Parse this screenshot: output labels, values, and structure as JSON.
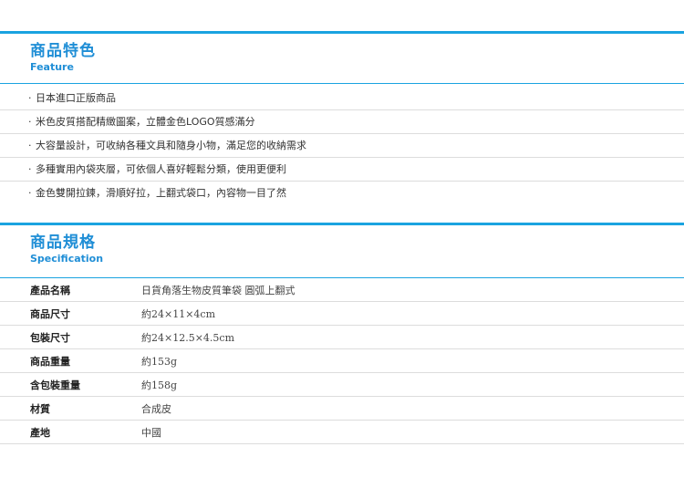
{
  "feature": {
    "title": "商品特色",
    "subtitle": "Feature",
    "bullet": "·",
    "items": [
      "日本進口正版商品",
      "米色皮質搭配精緻圖案，立體金色LOGO質感滿分",
      "大容量設計，可收納各種文具和隨身小物，滿足您的收納需求",
      "多種實用內袋夾層，可依個人喜好輕鬆分類，使用更便利",
      "金色雙開拉鍊，滑順好拉，上翻式袋口，內容物一目了然"
    ]
  },
  "spec": {
    "title": "商品規格",
    "subtitle": "Specification",
    "rows": [
      {
        "key": "產品名稱",
        "value": "日貨角落生物皮質筆袋 圓弧上翻式"
      },
      {
        "key": "商品尺寸",
        "value": "約24×11×4cm"
      },
      {
        "key": "包裝尺寸",
        "value": "約24×12.5×4.5cm"
      },
      {
        "key": "商品重量",
        "value": "約153g"
      },
      {
        "key": "含包裝重量",
        "value": "約158g"
      },
      {
        "key": "材質",
        "value": "合成皮"
      },
      {
        "key": "產地",
        "value": "中國"
      }
    ]
  },
  "colors": {
    "accent": "#1aa3e0",
    "heading": "#1f8ed6",
    "divider": "#dcdcdc"
  }
}
